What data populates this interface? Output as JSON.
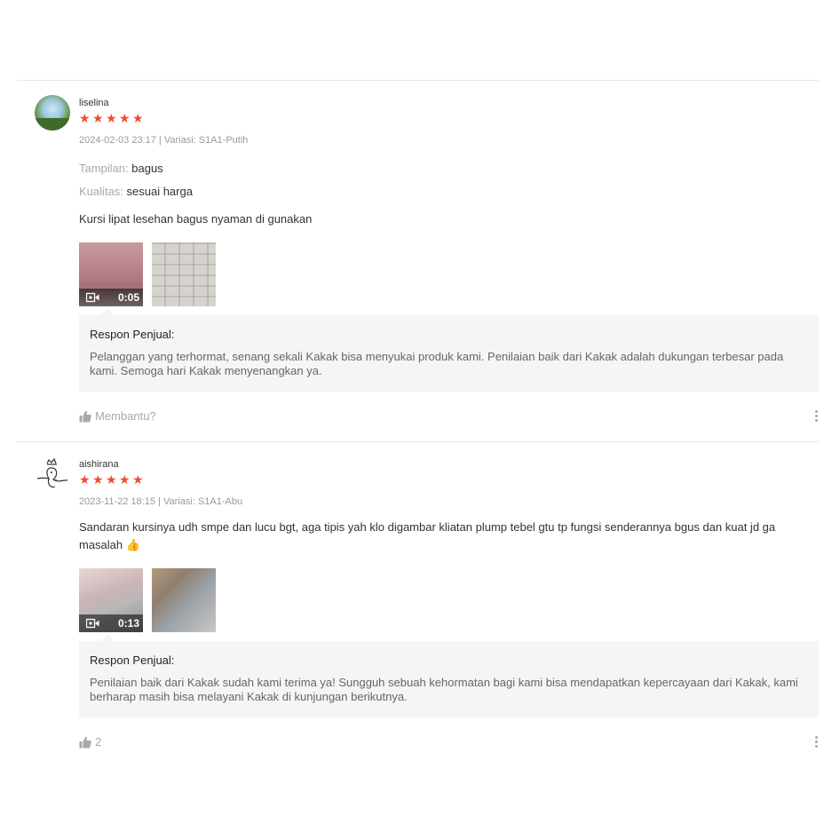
{
  "reviews": [
    {
      "username": "liselina",
      "rating": 5,
      "date": "2024-02-03 23:17",
      "separator": " | ",
      "variant": "Variasi: S1A1-Putih",
      "attributes": [
        {
          "label": "Tampilan:",
          "value": "bagus"
        },
        {
          "label": "Kualitas:",
          "value": "sesuai harga"
        }
      ],
      "comment": "Kursi lipat lesehan bagus nyaman di gunakan",
      "media": [
        {
          "type": "video",
          "duration": "0:05"
        },
        {
          "type": "image"
        }
      ],
      "reply_title": "Respon Penjual:",
      "reply_text": "Pelanggan yang terhormat, senang sekali Kakak bisa menyukai produk kami. Penilaian baik dari Kakak adalah dukungan terbesar pada kami. Semoga hari Kakak menyenangkan ya.",
      "helpful_label": "Membantu?"
    },
    {
      "username": "aishirana",
      "rating": 5,
      "date": "2023-11-22 18:15",
      "separator": " | ",
      "variant": "Variasi: S1A1-Abu",
      "attributes": [],
      "comment": "Sandaran kursinya udh smpe dan lucu bgt, aga tipis yah klo digambar kliatan plump tebel gtu tp fungsi senderannya bgus dan kuat jd ga masalah 👍",
      "media": [
        {
          "type": "video",
          "duration": "0:13"
        },
        {
          "type": "image"
        }
      ],
      "reply_title": "Respon Penjual:",
      "reply_text": "Penilaian baik dari Kakak sudah kami terima ya! Sungguh sebuah kehormatan bagi kami bisa mendapatkan kepercayaan dari Kakak, kami berharap masih bisa melayani Kakak di kunjungan berikutnya.",
      "helpful_label": "2"
    }
  ],
  "colors": {
    "star": "#ee4d2d",
    "muted": "#a8a8a8",
    "reply_bg": "#f5f5f5"
  }
}
